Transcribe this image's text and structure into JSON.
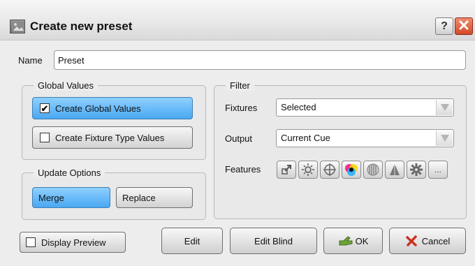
{
  "window": {
    "title": "Create new preset",
    "help_label": "?",
    "close_label": "✕"
  },
  "name": {
    "label": "Name",
    "value": "Preset"
  },
  "global_values": {
    "legend": "Global Values",
    "create_global": {
      "label": "Create Global Values",
      "checked": true,
      "active": true
    },
    "create_fixture_type": {
      "label": "Create Fixture Type Values",
      "checked": false,
      "active": false
    }
  },
  "update_options": {
    "legend": "Update Options",
    "merge_label": "Merge",
    "replace_label": "Replace",
    "selected": "Merge"
  },
  "filter": {
    "legend": "Filter",
    "fixtures_label": "Fixtures",
    "fixtures_value": "Selected",
    "output_label": "Output",
    "output_value": "Current Cue",
    "features_label": "Features",
    "feature_icons": [
      "position-icon",
      "intensity-icon",
      "focus-icon",
      "color-icon",
      "gobo-icon",
      "beam-icon",
      "control-icon",
      "more-icon"
    ],
    "more_label": "..."
  },
  "footer": {
    "display_preview": {
      "label": "Display Preview",
      "checked": false
    },
    "edit_label": "Edit",
    "edit_blind_label": "Edit Blind",
    "ok_label": "OK",
    "cancel_label": "Cancel"
  },
  "colors": {
    "active_blue": "#49a8f2",
    "close_red": "#d24a2a",
    "ok_green": "#5a8a2a",
    "cancel_red": "#c8321e"
  }
}
